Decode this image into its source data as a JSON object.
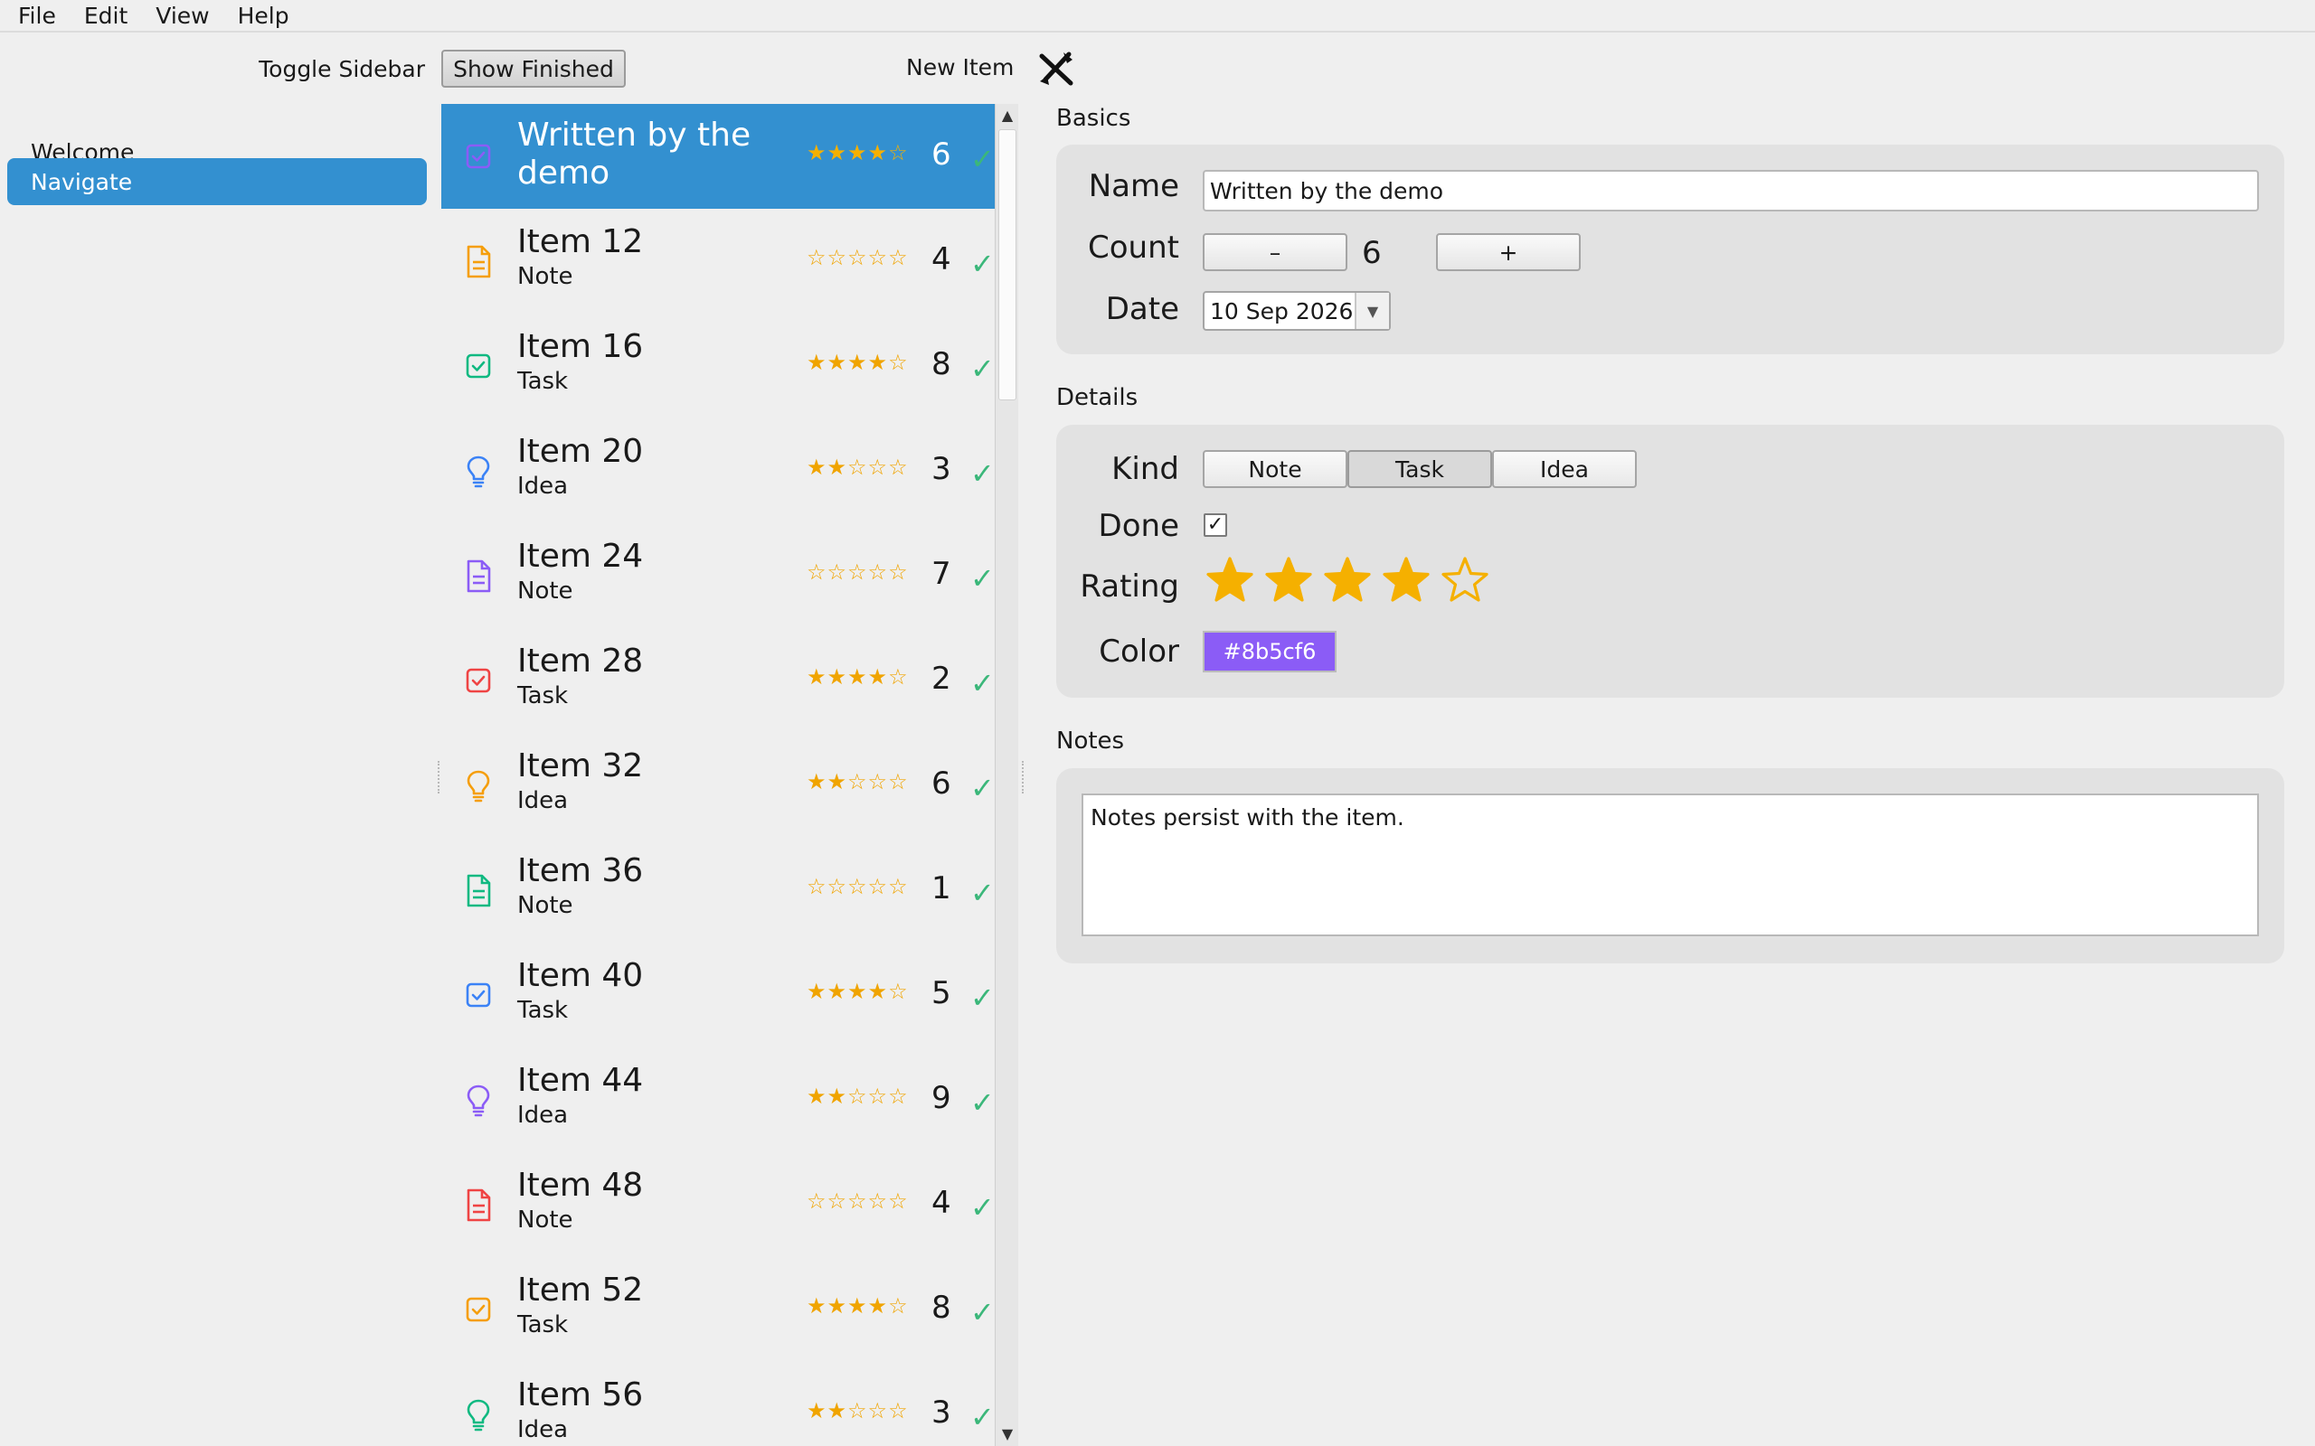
{
  "menu": [
    "File",
    "Edit",
    "View",
    "Help"
  ],
  "sidebar": {
    "toggle_label": "Toggle Sidebar",
    "items": [
      {
        "label": "Welcome",
        "selected": false
      },
      {
        "label": "Navigate",
        "selected": true
      }
    ]
  },
  "toolbar": {
    "show_finished_label": "Show Finished",
    "new_item_label": "New Item"
  },
  "list": {
    "items": [
      {
        "title": "Written by the demo",
        "subtitle": "",
        "stars": "★★★★☆",
        "rating": 4,
        "count": "6",
        "check": "✓",
        "kind": "task",
        "color": "#8b5cf6",
        "selected": true
      },
      {
        "title": "Item 12",
        "subtitle": "Note",
        "stars": "☆☆☆☆☆",
        "rating": 0,
        "count": "4",
        "check": "✓",
        "kind": "note",
        "color": "#f59e0b"
      },
      {
        "title": "Item 16",
        "subtitle": "Task",
        "stars": "★★★★☆",
        "rating": 4,
        "count": "8",
        "check": "✓",
        "kind": "task",
        "color": "#10b981"
      },
      {
        "title": "Item 20",
        "subtitle": "Idea",
        "stars": "★★☆☆☆",
        "rating": 2,
        "count": "3",
        "check": "✓",
        "kind": "idea",
        "color": "#3b82f6"
      },
      {
        "title": "Item 24",
        "subtitle": "Note",
        "stars": "☆☆☆☆☆",
        "rating": 0,
        "count": "7",
        "check": "✓",
        "kind": "note",
        "color": "#8b5cf6"
      },
      {
        "title": "Item 28",
        "subtitle": "Task",
        "stars": "★★★★☆",
        "rating": 4,
        "count": "2",
        "check": "✓",
        "kind": "task",
        "color": "#ef4444"
      },
      {
        "title": "Item 32",
        "subtitle": "Idea",
        "stars": "★★☆☆☆",
        "rating": 2,
        "count": "6",
        "check": "✓",
        "kind": "idea",
        "color": "#f59e0b"
      },
      {
        "title": "Item 36",
        "subtitle": "Note",
        "stars": "☆☆☆☆☆",
        "rating": 0,
        "count": "1",
        "check": "✓",
        "kind": "note",
        "color": "#10b981"
      },
      {
        "title": "Item 40",
        "subtitle": "Task",
        "stars": "★★★★☆",
        "rating": 4,
        "count": "5",
        "check": "✓",
        "kind": "task",
        "color": "#3b82f6"
      },
      {
        "title": "Item 44",
        "subtitle": "Idea",
        "stars": "★★☆☆☆",
        "rating": 2,
        "count": "9",
        "check": "✓",
        "kind": "idea",
        "color": "#8b5cf6"
      },
      {
        "title": "Item 48",
        "subtitle": "Note",
        "stars": "☆☆☆☆☆",
        "rating": 0,
        "count": "4",
        "check": "✓",
        "kind": "note",
        "color": "#ef4444"
      },
      {
        "title": "Item 52",
        "subtitle": "Task",
        "stars": "★★★★☆",
        "rating": 4,
        "count": "8",
        "check": "✓",
        "kind": "task",
        "color": "#f59e0b"
      },
      {
        "title": "Item 56",
        "subtitle": "Idea",
        "stars": "★★☆☆☆",
        "rating": 2,
        "count": "3",
        "check": "✓",
        "kind": "idea",
        "color": "#10b981"
      }
    ]
  },
  "detail": {
    "basics": {
      "section_title": "Basics",
      "name_label": "Name",
      "name_value": "Written by the demo",
      "count_label": "Count",
      "count_value": "6",
      "decrement_label": "–",
      "increment_label": "+",
      "date_label": "Date",
      "date_value": "10 Sep 2026"
    },
    "details": {
      "section_title": "Details",
      "kind_label": "Kind",
      "kind_options": [
        "Note",
        "Task",
        "Idea"
      ],
      "kind_selected": "Task",
      "done_label": "Done",
      "done_mark": "✓",
      "done": true,
      "rating_label": "Rating",
      "rating": 4,
      "rating_max": 5,
      "color_label": "Color",
      "color_value": "#8b5cf6"
    },
    "notes": {
      "section_title": "Notes",
      "text": "Notes persist with the item."
    }
  },
  "colors": {
    "accent": "#3390d0",
    "star": "#f5b000",
    "check": "#3bb77a"
  }
}
